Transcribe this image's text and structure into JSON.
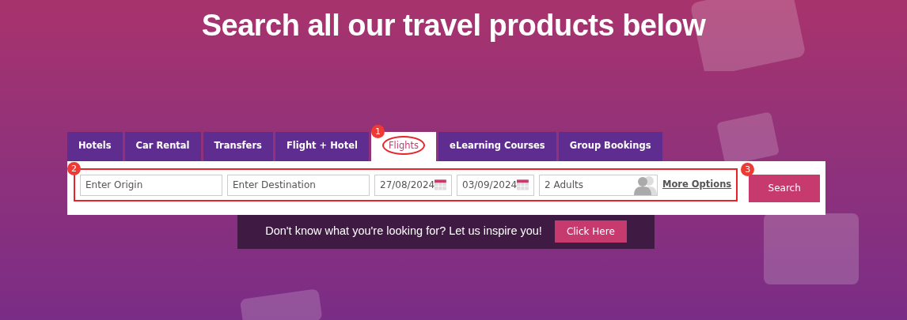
{
  "heading": "Search all our travel products below",
  "tabs": [
    {
      "label": "Hotels",
      "selected": false
    },
    {
      "label": "Car Rental",
      "selected": false
    },
    {
      "label": "Transfers",
      "selected": false
    },
    {
      "label": "Flight + Hotel",
      "selected": false
    },
    {
      "label": "Flights",
      "selected": true,
      "callout": "1"
    },
    {
      "label": "eLearning Courses",
      "selected": false
    },
    {
      "label": "Group Bookings",
      "selected": false
    }
  ],
  "search_form": {
    "callout": "2",
    "fields": [
      {
        "kind": "text",
        "placeholder": "Enter Origin"
      },
      {
        "kind": "text",
        "placeholder": "Enter Destination"
      },
      {
        "kind": "date",
        "value": "27/08/2024"
      },
      {
        "kind": "date",
        "value": "03/09/2024"
      },
      {
        "kind": "guests",
        "value": "2 Adults"
      }
    ],
    "more_options": "More Options",
    "search_button": {
      "label": "Search",
      "callout": "3"
    }
  },
  "inspire": {
    "text": "Don't know what you're looking for? Let us inspire you!",
    "button": "Click Here"
  }
}
